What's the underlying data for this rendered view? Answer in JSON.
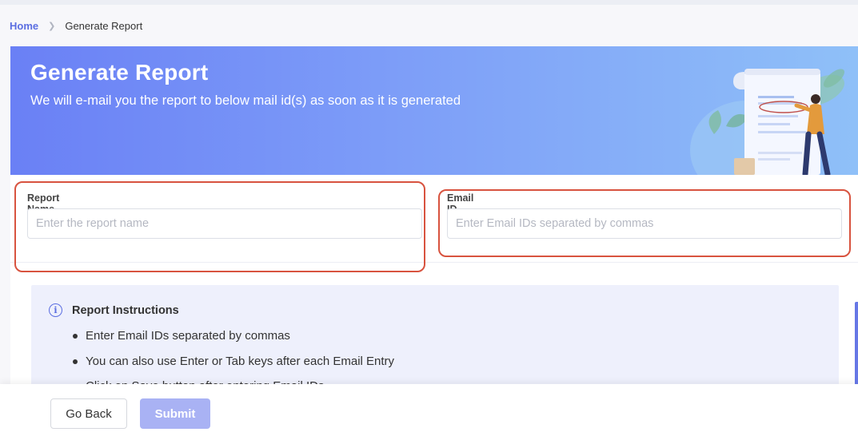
{
  "breadcrumb": {
    "home": "Home",
    "current": "Generate Report"
  },
  "banner": {
    "title": "Generate Report",
    "subtitle": "We will e-mail you the report to below mail id(s) as soon as it is generated"
  },
  "form": {
    "report_name": {
      "label": "Report Name",
      "placeholder": "Enter the report name",
      "value": ""
    },
    "email": {
      "label": "Email ID",
      "placeholder": "Enter Email IDs separated by commas",
      "value": ""
    }
  },
  "instructions": {
    "title": "Report Instructions",
    "items": [
      "Enter Email IDs separated by commas",
      "You can also use Enter or Tab keys after each Email Entry",
      "Click on Save button after entering Email IDs"
    ]
  },
  "footer": {
    "back_label": "Go Back",
    "submit_label": "Submit"
  },
  "colors": {
    "accent": "#5b6ee1",
    "highlight": "#d8533f",
    "banner_start": "#6a80f5",
    "banner_end": "#8fc0f8",
    "submit_disabled": "#a9b2f4"
  },
  "icons": {
    "breadcrumb_separator": "chevron-right-icon",
    "info": "info-icon"
  }
}
